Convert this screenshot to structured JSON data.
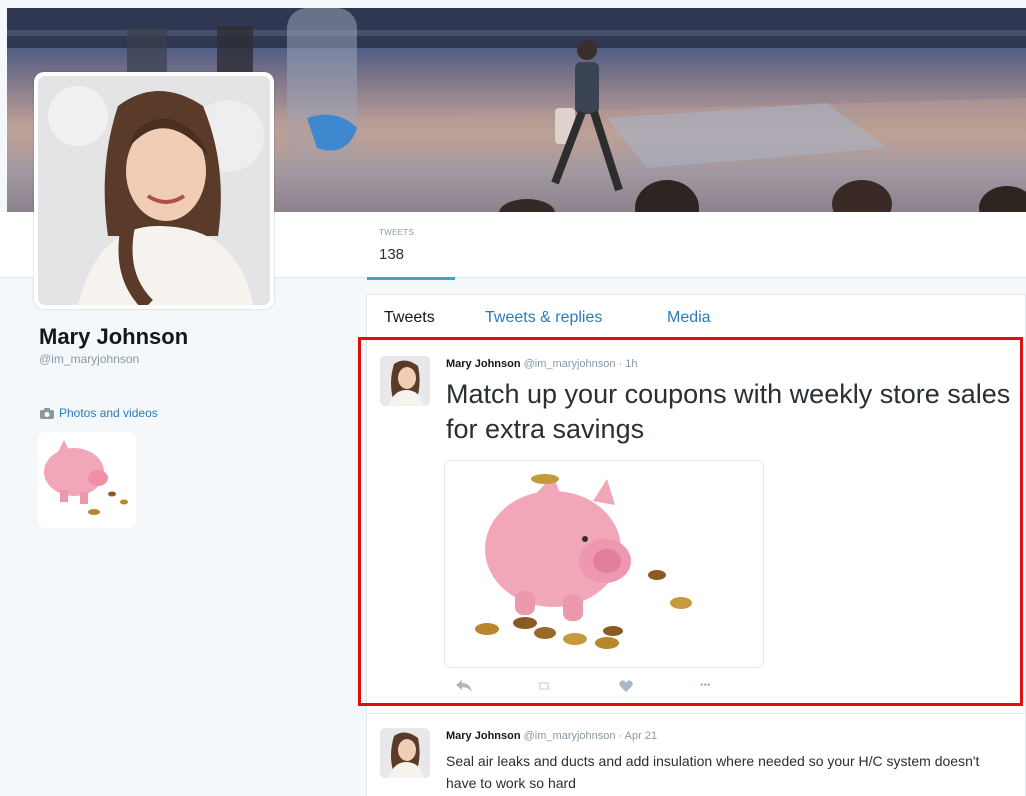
{
  "profile": {
    "name": "Mary Johnson",
    "handle": "@im_maryjohnson",
    "photos_link": "Photos and videos"
  },
  "stats": {
    "tweets_label": "TWEETS",
    "tweets_count": "138"
  },
  "tabs": [
    {
      "label": "Tweets"
    },
    {
      "label": "Tweets & replies"
    },
    {
      "label": "Media"
    }
  ],
  "tweets": [
    {
      "name": "Mary Johnson",
      "meta": "@im_maryjohnson · 1h",
      "text": "Match up your coupons with weekly store sales for extra savings"
    },
    {
      "name": "Mary Johnson",
      "meta": "@im_maryjohnson · Apr 21",
      "text": "Seal air leaks and ducts and add insulation where needed so your H/C system doesn't have to work so hard"
    }
  ],
  "actions": {
    "reply_icon": "reply-icon",
    "retweet_icon": "retweet-icon",
    "like_icon": "heart-icon",
    "more_icon": "more-icon",
    "more_glyph": "•••"
  },
  "colors": {
    "link": "#2b7bb9",
    "highlight": "#e10e0e",
    "tab_underline": "#3fa0d8"
  }
}
